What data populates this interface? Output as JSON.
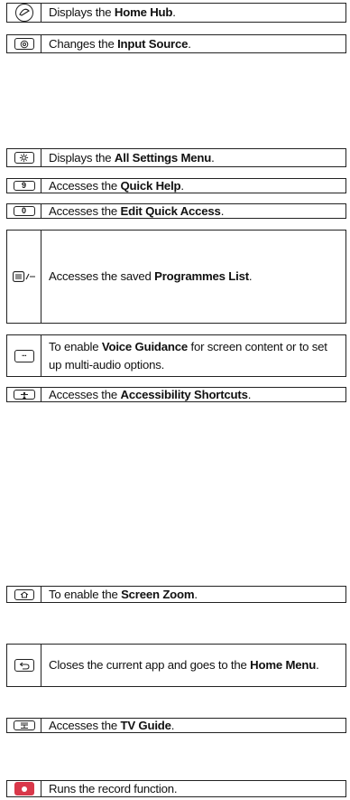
{
  "rows": [
    {
      "icon": "home-hub-button-icon",
      "pre": "Displays the ",
      "bold": "Home Hub",
      "post": "."
    },
    {
      "icon": "input-source-button-icon",
      "pre": "Changes the ",
      "bold": "Input Source",
      "post": "."
    },
    {
      "icon": "settings-gear-button-icon",
      "pre": "Displays the ",
      "bold": "All Settings Menu",
      "post": "."
    },
    {
      "icon": "number-9-button-icon",
      "key": "9",
      "pre": "Accesses the ",
      "bold": "Quick Help",
      "post": "."
    },
    {
      "icon": "number-0-button-icon",
      "key": "0",
      "pre": "Accesses the ",
      "bold": "Edit Quick Access",
      "post": "."
    },
    {
      "icon": "programme-list-button-icon",
      "pre": "Accesses the saved ",
      "bold": "Programmes List",
      "post": "."
    },
    {
      "icon": "voice-guidance-button-icon",
      "pre": "To enable ",
      "bold": "Voice Guidance",
      "post": " for screen content or to set up multi-audio options."
    },
    {
      "icon": "accessibility-button-icon",
      "pre": "Accesses the ",
      "bold": "Accessibility Shortcuts",
      "post": "."
    },
    {
      "icon": "screen-zoom-button-icon",
      "pre": "To enable the ",
      "bold": "Screen Zoom",
      "post": "."
    },
    {
      "icon": "back-button-icon",
      "pre": "Closes the current app and goes to the ",
      "bold": "Home Menu",
      "post": "."
    },
    {
      "icon": "tv-guide-button-icon",
      "pre": "Accesses the ",
      "bold": "TV Guide",
      "post": "."
    },
    {
      "icon": "record-button-icon",
      "pre": "Runs the record function.",
      "bold": "",
      "post": ""
    }
  ]
}
